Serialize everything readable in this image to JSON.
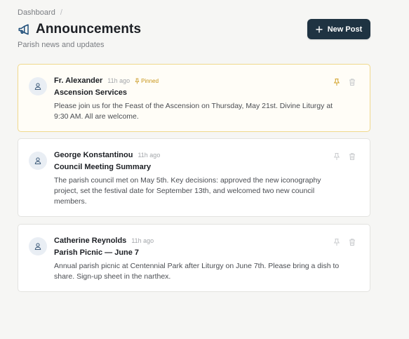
{
  "breadcrumb": {
    "root": "Dashboard",
    "separator": "/"
  },
  "header": {
    "title": "Announcements",
    "subtitle": "Parish news and updates",
    "new_post_label": "New Post"
  },
  "colors": {
    "accent": "#1f3342",
    "pinned": "#c9961a",
    "pinned_border": "#f0d98c"
  },
  "posts": [
    {
      "author": "Fr. Alexander",
      "time": "11h ago",
      "badge": "Pinned",
      "title": "Ascension Services",
      "body": "Please join us for the Feast of the Ascension on Thursday, May 21st. Divine Liturgy at 9:30 AM. All are welcome."
    },
    {
      "author": "George Konstantinou",
      "time": "11h ago",
      "title": "Council Meeting Summary",
      "body": "The parish council met on May 5th. Key decisions: approved the new iconography project, set the festival date for September 13th, and welcomed two new council members."
    },
    {
      "author": "Catherine Reynolds",
      "time": "11h ago",
      "title": "Parish Picnic — June 7",
      "body": "Annual parish picnic at Centennial Park after Liturgy on June 7th. Please bring a dish to share. Sign-up sheet in the narthex."
    }
  ]
}
